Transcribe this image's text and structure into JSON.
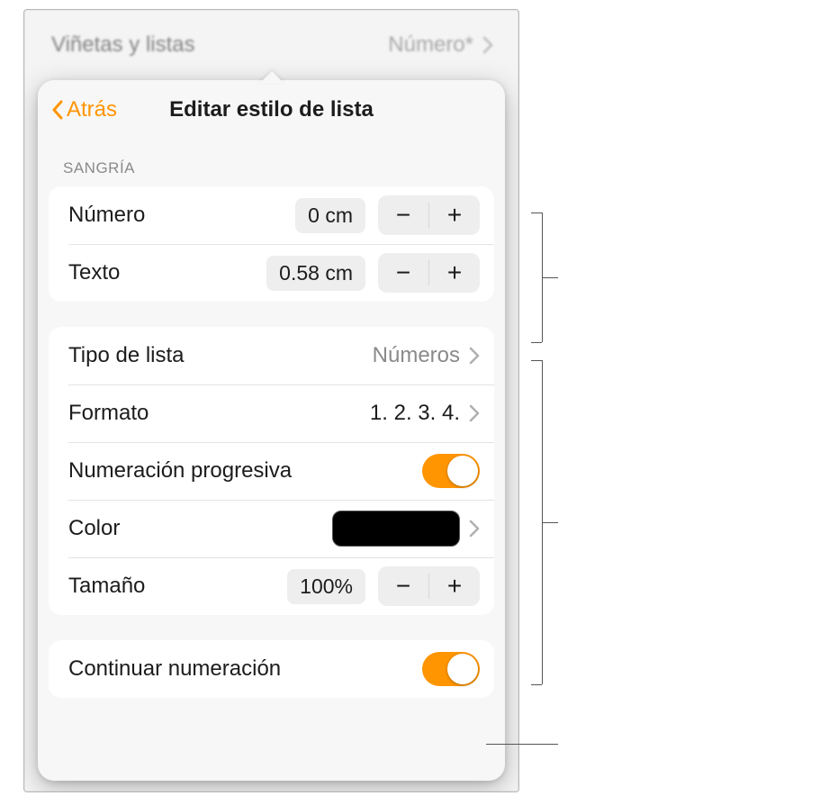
{
  "topbar": {
    "left_label": "Viñetas y listas",
    "right_label": "Número*"
  },
  "panel": {
    "back_label": "Atrás",
    "title": "Editar estilo de lista",
    "section_indent": "SANGRÍA",
    "rows": {
      "number_indent": {
        "label": "Número",
        "value": "0 cm"
      },
      "text_indent": {
        "label": "Texto",
        "value": "0.58 cm"
      },
      "list_type": {
        "label": "Tipo de lista",
        "value": "Números"
      },
      "format": {
        "label": "Formato",
        "value": "1. 2. 3. 4."
      },
      "progressive": {
        "label": "Numeración progresiva"
      },
      "color": {
        "label": "Color",
        "value_hex": "#000000"
      },
      "size": {
        "label": "Tamaño",
        "value": "100%"
      },
      "continue_num": {
        "label": "Continuar numeración"
      }
    }
  }
}
